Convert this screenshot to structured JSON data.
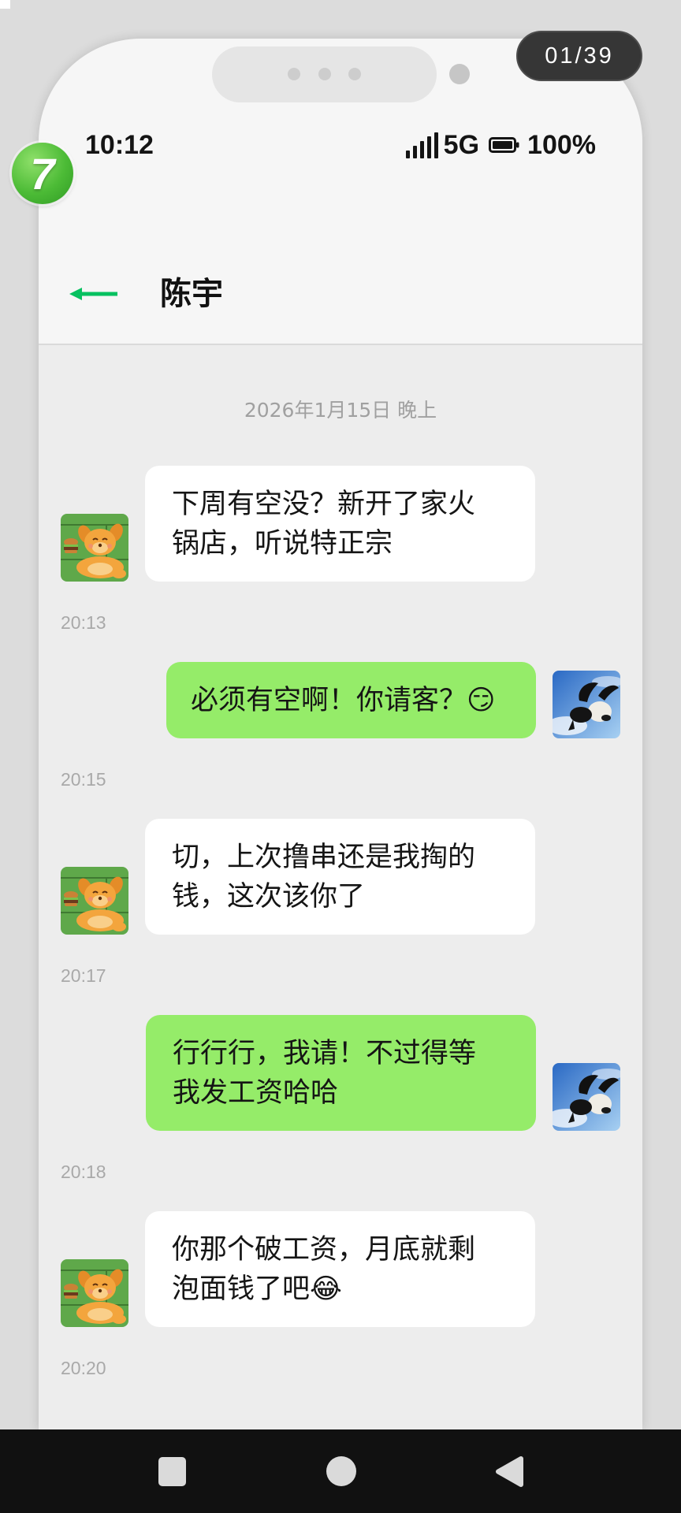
{
  "viewer": {
    "page_counter": "01/39"
  },
  "logo": {
    "mark": "7"
  },
  "status_bar": {
    "time": "10:12",
    "network": "5G",
    "battery": "100%",
    "icons": {
      "signal": "signal-bars-icon",
      "battery": "battery-icon"
    }
  },
  "header": {
    "title": "陈宇",
    "back_icon": "arrow-left-icon"
  },
  "chat": {
    "date_separator": "2026年1月15日 晚上",
    "messages": [
      {
        "outgoing": false,
        "text": "下周有空没？新开了家火锅店，听说特正宗",
        "time": "20:13"
      },
      {
        "outgoing": true,
        "text": "必须有空啊！你请客？😏",
        "time": "20:15"
      },
      {
        "outgoing": false,
        "text": "切，上次撸串还是我掏的钱，这次该你了",
        "time": "20:17"
      },
      {
        "outgoing": true,
        "text": "行行行，我请！不过得等我发工资哈哈",
        "time": "20:18"
      },
      {
        "outgoing": false,
        "text": "你那个破工资，月底就剩泡面钱了吧😂",
        "time": "20:20"
      }
    ]
  },
  "nav_bar": {
    "icons": {
      "recents": "square-icon",
      "home": "circle-icon",
      "back": "triangle-back-icon"
    }
  },
  "colors": {
    "accent": "#07c160",
    "sent_bubble": "#95ec69",
    "received_bubble": "#ffffff",
    "chat_background": "#ededed",
    "header_background": "#f6f6f6",
    "nav_bar": "#111111",
    "page_background": "#dcdcdc"
  }
}
